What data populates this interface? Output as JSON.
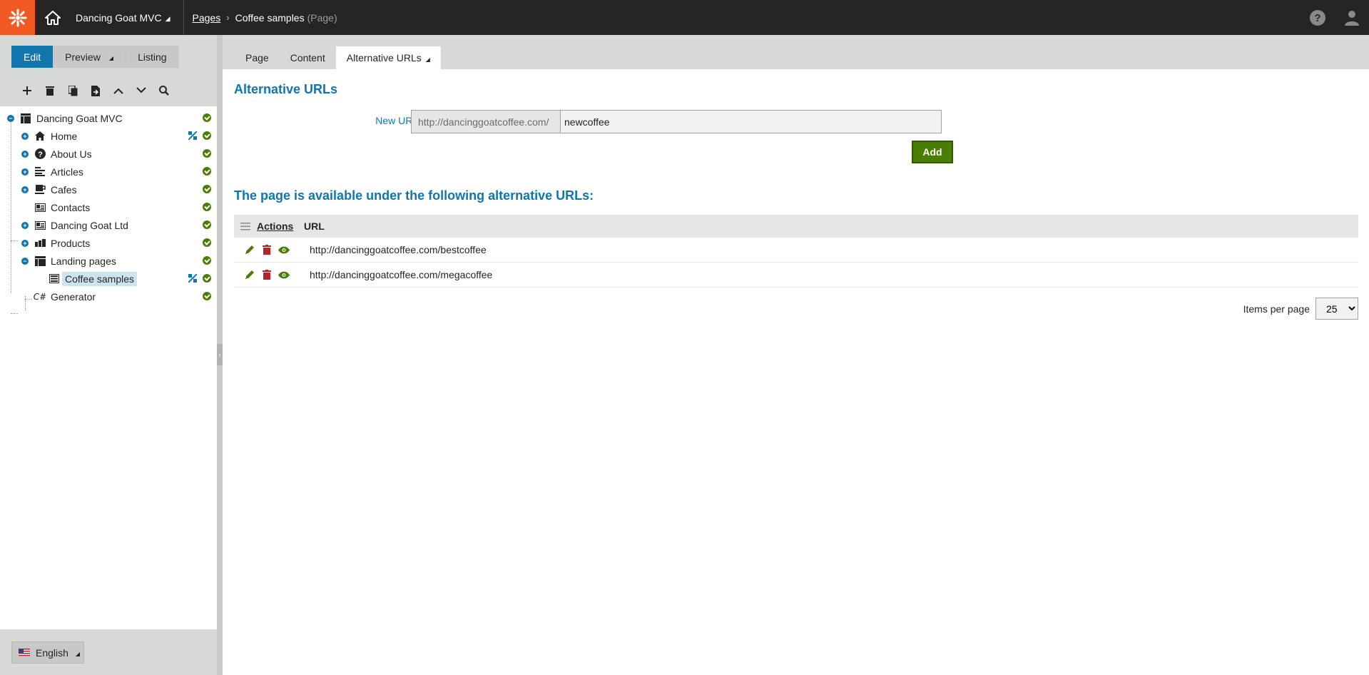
{
  "topbar": {
    "site_name": "Dancing Goat MVC",
    "breadcrumb_link": "Pages",
    "breadcrumb_current": "Coffee samples",
    "breadcrumb_type": "(Page)"
  },
  "modes": {
    "edit": "Edit",
    "preview": "Preview",
    "listing": "Listing"
  },
  "tree": [
    {
      "label": "Dancing Goat MVC",
      "icon": "site-icon",
      "toggle": "minus"
    },
    {
      "label": "Home",
      "icon": "home-icon",
      "toggle": "plus",
      "workflow": true
    },
    {
      "label": "About Us",
      "icon": "question-icon",
      "toggle": "plus"
    },
    {
      "label": "Articles",
      "icon": "list-icon",
      "toggle": "plus"
    },
    {
      "label": "Cafes",
      "icon": "cup-icon",
      "toggle": "plus"
    },
    {
      "label": "Contacts",
      "icon": "contact-card-icon",
      "toggle": "none"
    },
    {
      "label": "Dancing Goat Ltd",
      "icon": "contact-card-icon",
      "toggle": "plus"
    },
    {
      "label": "Products",
      "icon": "boxes-icon",
      "toggle": "plus"
    },
    {
      "label": "Landing pages",
      "icon": "layout-icon",
      "toggle": "minus"
    },
    {
      "label": "Coffee samples",
      "icon": "page-icon",
      "toggle": "none",
      "selected": true,
      "workflow": true
    },
    {
      "label": "Generator",
      "icon": "csharp-icon",
      "toggle": "none"
    }
  ],
  "language": "English",
  "tabs": {
    "page": "Page",
    "content": "Content",
    "alt_urls": "Alternative URLs"
  },
  "form": {
    "heading": "Alternative URLs",
    "new_url_label": "New URL:",
    "url_prefix": "http://dancinggoatcoffee.com/",
    "url_value": "newcoffee",
    "add_label": "Add"
  },
  "list": {
    "heading": "The page is available under the following alternative URLs:",
    "col_actions": "Actions",
    "col_url": "URL",
    "rows": [
      "http://dancinggoatcoffee.com/bestcoffee",
      "http://dancinggoatcoffee.com/megacoffee"
    ]
  },
  "pager": {
    "label": "Items per page",
    "value": "25"
  },
  "colors": {
    "brand": "#f05a22",
    "primary": "#1175ae",
    "success": "#497d04",
    "danger": "#b12628"
  }
}
